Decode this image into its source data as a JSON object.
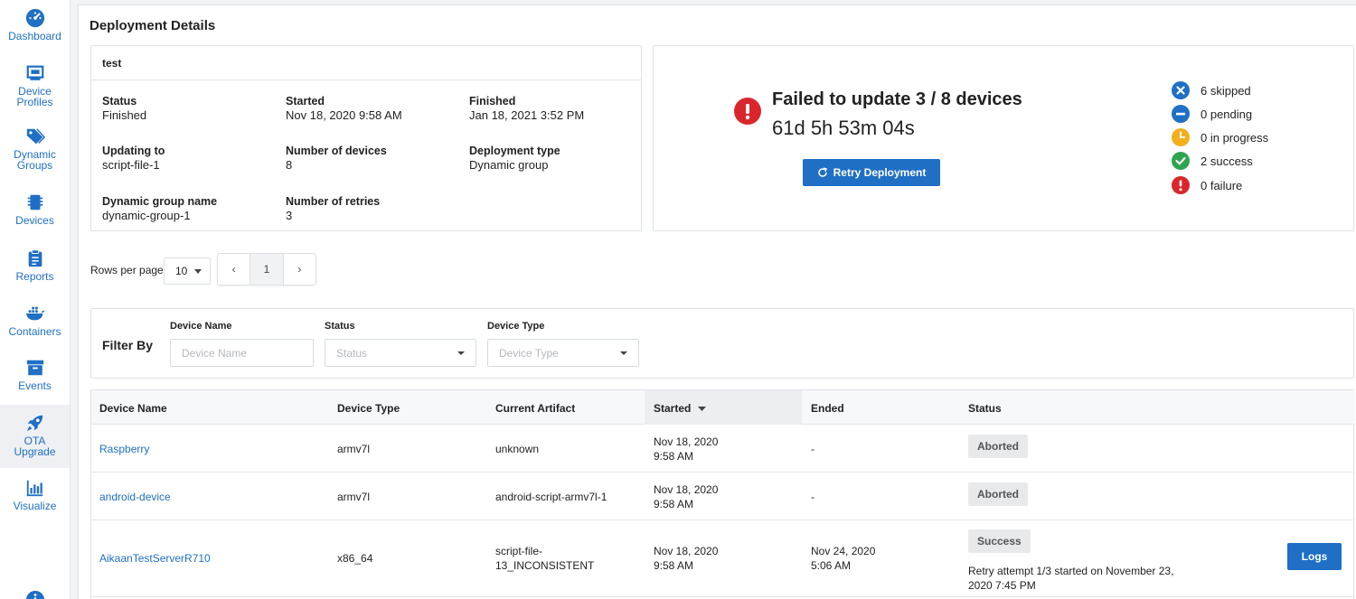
{
  "sidebar": {
    "items": [
      {
        "label": "Dashboard",
        "icon": "gauge-icon"
      },
      {
        "label": "Device Profiles",
        "icon": "device-profiles-icon"
      },
      {
        "label": "Dynamic Groups",
        "icon": "tags-icon"
      },
      {
        "label": "Devices",
        "icon": "chip-icon"
      },
      {
        "label": "Reports",
        "icon": "clipboard-icon"
      },
      {
        "label": "Containers",
        "icon": "docker-icon"
      },
      {
        "label": "Events",
        "icon": "archive-box-icon"
      },
      {
        "label": "OTA Upgrade",
        "icon": "rocket-icon"
      },
      {
        "label": "Visualize",
        "icon": "bar-chart-icon"
      }
    ],
    "active": "OTA Upgrade"
  },
  "page": {
    "title": "Deployment Details"
  },
  "deployment": {
    "name": "test",
    "status_label": "Status",
    "status": "Finished",
    "started_label": "Started",
    "started": "Nov 18, 2020 9:58 AM",
    "finished_label": "Finished",
    "finished": "Jan 18, 2021 3:52 PM",
    "updating_to_label": "Updating to",
    "updating_to": "script-file-1",
    "num_devices_label": "Number of devices",
    "num_devices": "8",
    "deployment_type_label": "Deployment type",
    "deployment_type": "Dynamic group",
    "group_name_label": "Dynamic group name",
    "group_name": "dynamic-group-1",
    "num_retries_label": "Number of retries",
    "num_retries": "3"
  },
  "summary": {
    "title": "Failed to update 3 / 8 devices",
    "duration": "61d 5h 53m 04s",
    "retry_label": "Retry Deployment",
    "stats": [
      {
        "label": "6 skipped",
        "color": "#1f6fc5",
        "icon": "x-circle-icon"
      },
      {
        "label": "0 pending",
        "color": "#1f6fc5",
        "icon": "minus-circle-icon"
      },
      {
        "label": "0 in progress",
        "color": "#f2b01e",
        "icon": "clock-icon"
      },
      {
        "label": "2 success",
        "color": "#2ea44f",
        "icon": "check-circle-icon"
      },
      {
        "label": "0 failure",
        "color": "#d9262c",
        "icon": "exclamation-circle-icon"
      }
    ]
  },
  "pagination": {
    "rows_per_page_label": "Rows per page",
    "rows_per_page": "10",
    "prev": "‹",
    "page": "1",
    "next": "›"
  },
  "filter": {
    "title": "Filter By",
    "device_name_label": "Device Name",
    "device_name_placeholder": "Device Name",
    "status_label": "Status",
    "status_placeholder": "Status",
    "device_type_label": "Device Type",
    "device_type_placeholder": "Device Type"
  },
  "table": {
    "headers": [
      "Device Name",
      "Device Type",
      "Current Artifact",
      "Started",
      "Ended",
      "Status"
    ],
    "rows": [
      {
        "name": "Raspberry",
        "type": "armv7l",
        "artifact": "unknown",
        "started_date": "Nov 18, 2020",
        "started_time": "9:58 AM",
        "ended_date": "-",
        "ended_time": "",
        "status": "Aborted",
        "note": ""
      },
      {
        "name": "android-device",
        "type": "armv7l",
        "artifact": "android-script-armv7l-1",
        "started_date": "Nov 18, 2020",
        "started_time": "9:58 AM",
        "ended_date": "-",
        "ended_time": "",
        "status": "Aborted",
        "note": ""
      },
      {
        "name": "AikaanTestServerR710",
        "type": "x86_64",
        "artifact": "script-file-13_INCONSISTENT",
        "artifact_line1": "script-file-",
        "artifact_line2": "13_INCONSISTENT",
        "started_date": "Nov 18, 2020",
        "started_time": "9:58 AM",
        "ended_date": "Nov 24, 2020",
        "ended_time": "5:06 AM",
        "status": "Success",
        "note_line1": "Retry attempt 1/3 started on November 23,",
        "note_line2": "2020 7:45 PM",
        "logs_label": "Logs"
      }
    ]
  }
}
